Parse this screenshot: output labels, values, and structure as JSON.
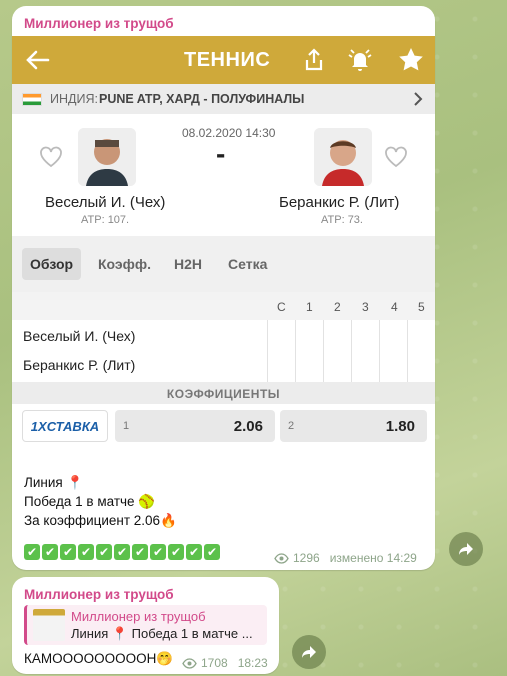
{
  "colors": {
    "accent": "#d24a8a",
    "topbar": "#cfa93a",
    "check": "#5cc14b"
  },
  "message1": {
    "sender": "Миллионер из трущоб",
    "screenshot": {
      "topbar": {
        "title": "ТЕННИС",
        "icons": [
          "arrow-left-icon",
          "share-icon",
          "bell-icon",
          "star-icon"
        ]
      },
      "league": {
        "country": "ИНДИЯ:",
        "tournament": "PUNE ATP, ХАРД - ПОЛУФИНАЛЫ"
      },
      "match": {
        "datetime": "08.02.2020 14:30",
        "score": "-",
        "player1": {
          "name": "Веселый И. (Чех)",
          "rank": "ATP: 107."
        },
        "player2": {
          "name": "Беранкис Р. (Лит)",
          "rank": "ATP: 73."
        }
      },
      "tabs": [
        "Обзор",
        "Коэфф.",
        "H2H",
        "Сетка"
      ],
      "score_table": {
        "columns": [
          "С",
          "1",
          "2",
          "3",
          "4",
          "5"
        ],
        "rows": [
          "Веселый И. (Чех)",
          "Беранкис Р. (Лит)"
        ]
      },
      "odds": {
        "header": "КОЭФФИЦИЕНТЫ",
        "bookmaker": "1XСТАВКА",
        "options": [
          {
            "label": "1",
            "value": "2.06"
          },
          {
            "label": "2",
            "value": "1.80"
          }
        ]
      }
    },
    "text_lines": [
      "Линия 📍",
      "Победа 1 в матче 🥎",
      "За коэффициент 2.06🔥"
    ],
    "checkmarks": [
      "✔",
      "✔",
      "✔",
      "✔",
      "✔",
      "✔",
      "✔",
      "✔",
      "✔",
      "✔",
      "✔"
    ],
    "views": "1296",
    "edited": "изменено 14:29"
  },
  "message2": {
    "sender": "Миллионер из трущоб",
    "reply": {
      "sender": "Миллионер из трущоб",
      "text": "Линия 📍 Победа 1 в матче ..."
    },
    "text": "КАМОООООООООН🤭",
    "views": "1708",
    "time": "18:23"
  }
}
